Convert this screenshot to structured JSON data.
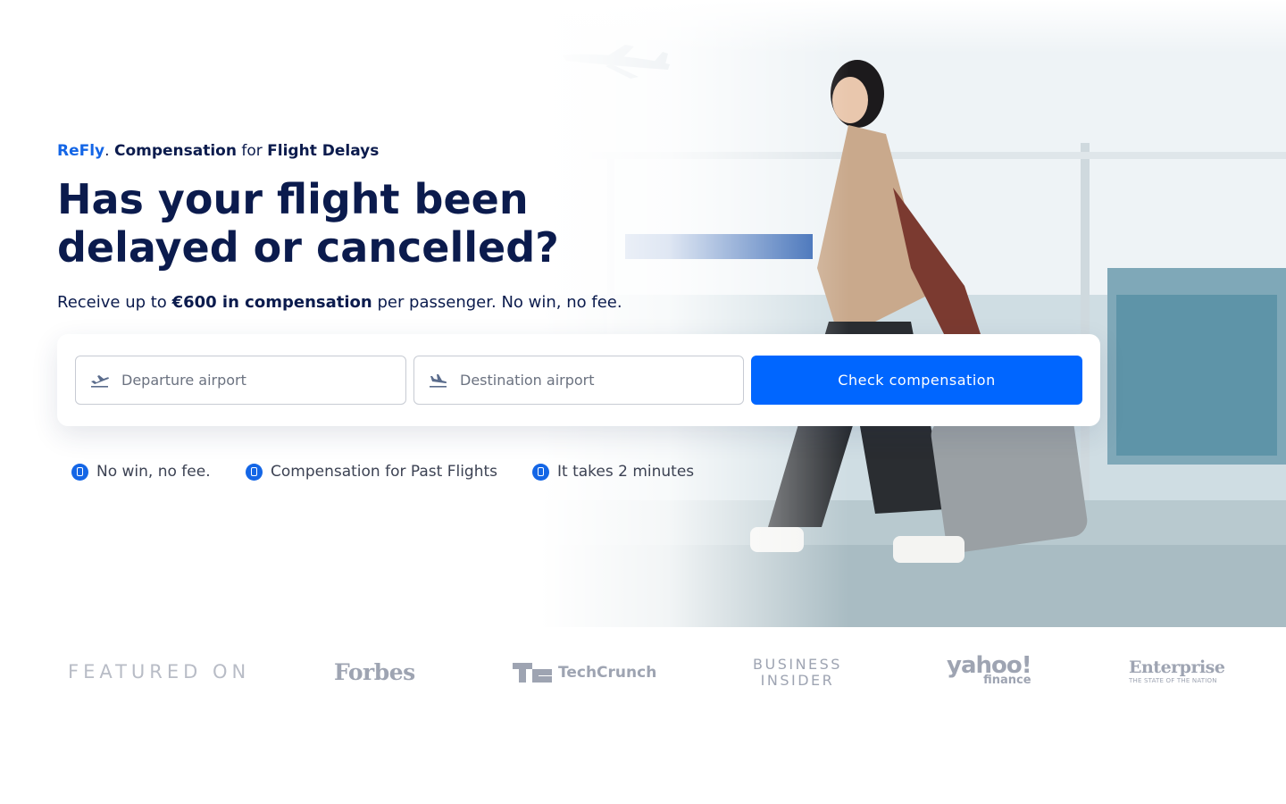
{
  "brand": {
    "name": "ReFly",
    "accent": "#1466e6",
    "navy": "#0b1b4d",
    "cta_color": "#0066ff"
  },
  "tagline": {
    "brand": "ReFly",
    "separator": ".",
    "part1": "Compensation",
    "connector": "for",
    "part2": "Flight Delays"
  },
  "hero": {
    "headline": "Has your flight been delayed or cancelled?",
    "sub_prefix": "Receive up to",
    "sub_bold": "€600 in compensation",
    "sub_suffix": "per passenger. No win, no fee."
  },
  "search": {
    "departure": {
      "icon": "plane-departure-icon",
      "value": "",
      "placeholder": "Departure airport"
    },
    "destination": {
      "icon": "plane-arrival-icon",
      "value": "",
      "placeholder": "Destination airport"
    },
    "cta_label": "Check compensation"
  },
  "benefits": [
    {
      "icon": "phone-icon",
      "label": "No win, no fee."
    },
    {
      "icon": "phone-icon",
      "label": "Compensation for Past Flights"
    },
    {
      "icon": "phone-icon",
      "label": "It takes 2 minutes"
    }
  ],
  "featured": {
    "label": "FEATURED ON",
    "logos": {
      "forbes": "Forbes",
      "techcrunch": "TechCrunch",
      "business_insider_line1": "BUSINESS",
      "business_insider_line2": "INSIDER",
      "yahoo": "yahoo!",
      "yahoo_sub": "finance",
      "enterprise": "Enterprise",
      "enterprise_sub": "THE STATE OF THE NATION"
    }
  }
}
